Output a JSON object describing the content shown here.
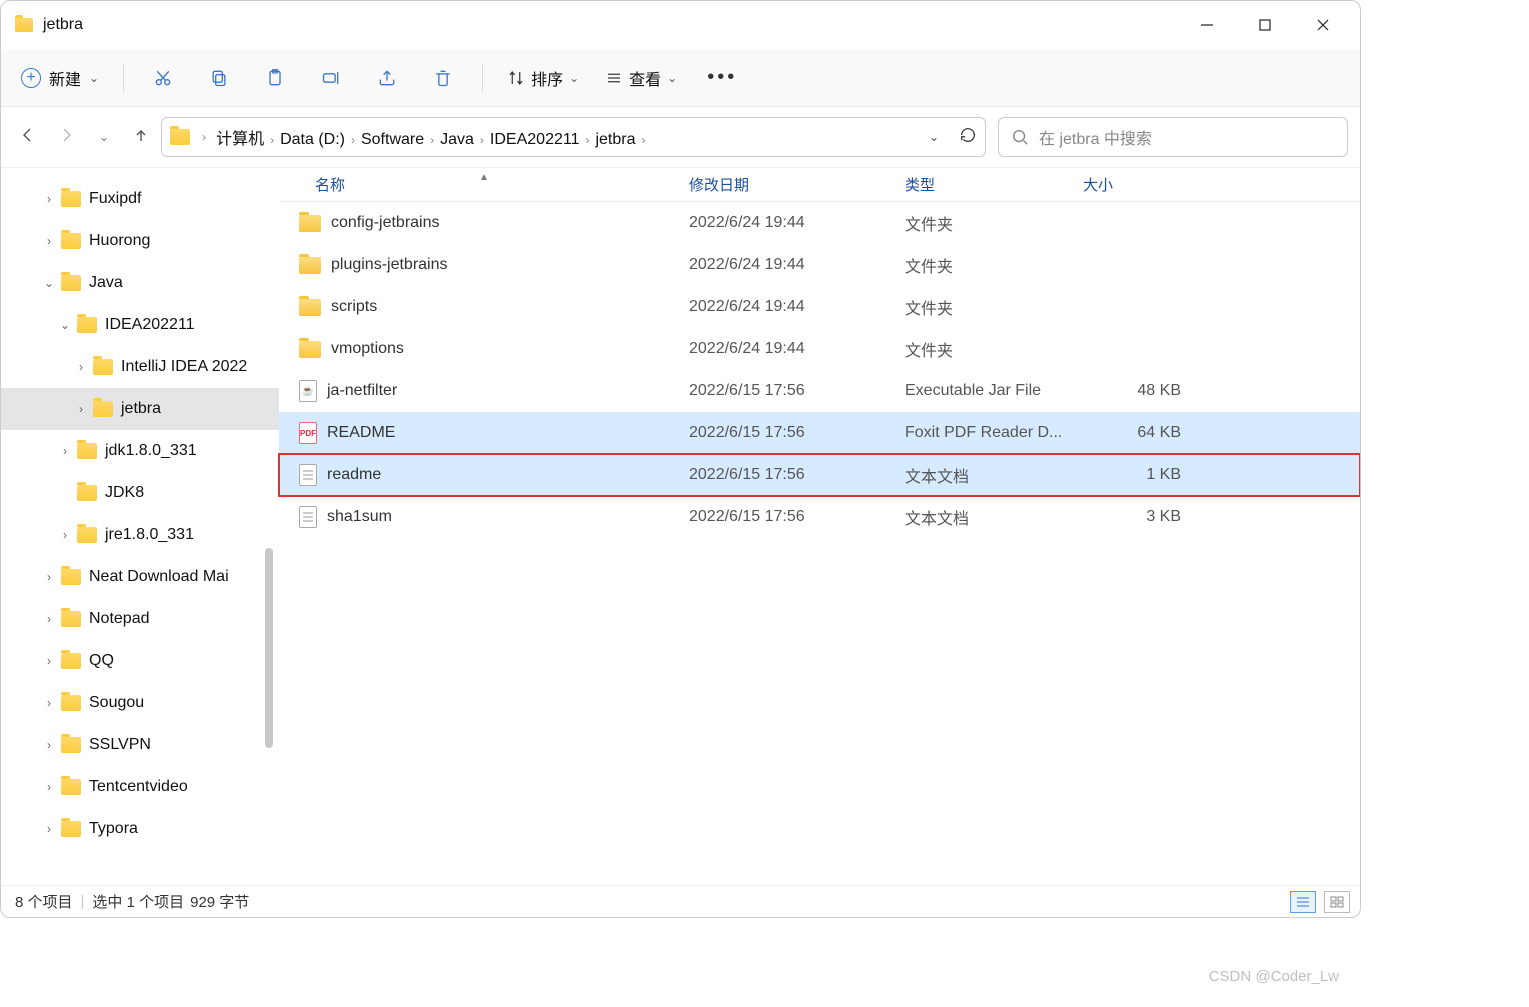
{
  "window": {
    "title": "jetbra"
  },
  "toolbar": {
    "new_label": "新建",
    "sort_label": "排序",
    "view_label": "查看"
  },
  "breadcrumbs": [
    "计算机",
    "Data (D:)",
    "Software",
    "Java",
    "IDEA202211",
    "jetbra"
  ],
  "search": {
    "placeholder": "在 jetbra 中搜索"
  },
  "tree": [
    {
      "name": "Fuxipdf",
      "indent": 1,
      "exp": "›"
    },
    {
      "name": "Huorong",
      "indent": 1,
      "exp": "›"
    },
    {
      "name": "Java",
      "indent": 1,
      "exp": "⌄"
    },
    {
      "name": "IDEA202211",
      "indent": 2,
      "exp": "⌄"
    },
    {
      "name": "IntelliJ IDEA 2022",
      "indent": 3,
      "exp": "›"
    },
    {
      "name": "jetbra",
      "indent": 3,
      "exp": "›",
      "sel": true
    },
    {
      "name": "jdk1.8.0_331",
      "indent": 2,
      "exp": "›"
    },
    {
      "name": "JDK8",
      "indent": 2,
      "exp": ""
    },
    {
      "name": "jre1.8.0_331",
      "indent": 2,
      "exp": "›"
    },
    {
      "name": "Neat Download Mai",
      "indent": 1,
      "exp": "›"
    },
    {
      "name": "Notepad",
      "indent": 1,
      "exp": "›"
    },
    {
      "name": "QQ",
      "indent": 1,
      "exp": "›"
    },
    {
      "name": "Sougou",
      "indent": 1,
      "exp": "›"
    },
    {
      "name": "SSLVPN",
      "indent": 1,
      "exp": "›"
    },
    {
      "name": "Tentcentvideo",
      "indent": 1,
      "exp": "›"
    },
    {
      "name": "Typora",
      "indent": 1,
      "exp": "›"
    }
  ],
  "columns": {
    "name": "名称",
    "date": "修改日期",
    "type": "类型",
    "size": "大小"
  },
  "files": [
    {
      "icon": "folder",
      "name": "config-jetbrains",
      "date": "2022/6/24 19:44",
      "type": "文件夹",
      "size": ""
    },
    {
      "icon": "folder",
      "name": "plugins-jetbrains",
      "date": "2022/6/24 19:44",
      "type": "文件夹",
      "size": ""
    },
    {
      "icon": "folder",
      "name": "scripts",
      "date": "2022/6/24 19:44",
      "type": "文件夹",
      "size": ""
    },
    {
      "icon": "folder",
      "name": "vmoptions",
      "date": "2022/6/24 19:44",
      "type": "文件夹",
      "size": ""
    },
    {
      "icon": "jar",
      "name": "ja-netfilter",
      "date": "2022/6/15 17:56",
      "type": "Executable Jar File",
      "size": "48 KB"
    },
    {
      "icon": "pdf",
      "name": "README",
      "date": "2022/6/15 17:56",
      "type": "Foxit PDF Reader D...",
      "size": "64 KB",
      "hl": true
    },
    {
      "icon": "file",
      "name": "readme",
      "date": "2022/6/15 17:56",
      "type": "文本文档",
      "size": "1 KB",
      "hl": true,
      "boxed": true
    },
    {
      "icon": "file",
      "name": "sha1sum",
      "date": "2022/6/15 17:56",
      "type": "文本文档",
      "size": "3 KB"
    }
  ],
  "status": {
    "items": "8 个项目",
    "selected": "选中 1 个项目",
    "bytes": "929 字节"
  },
  "watermark": "CSDN @Coder_Lw"
}
